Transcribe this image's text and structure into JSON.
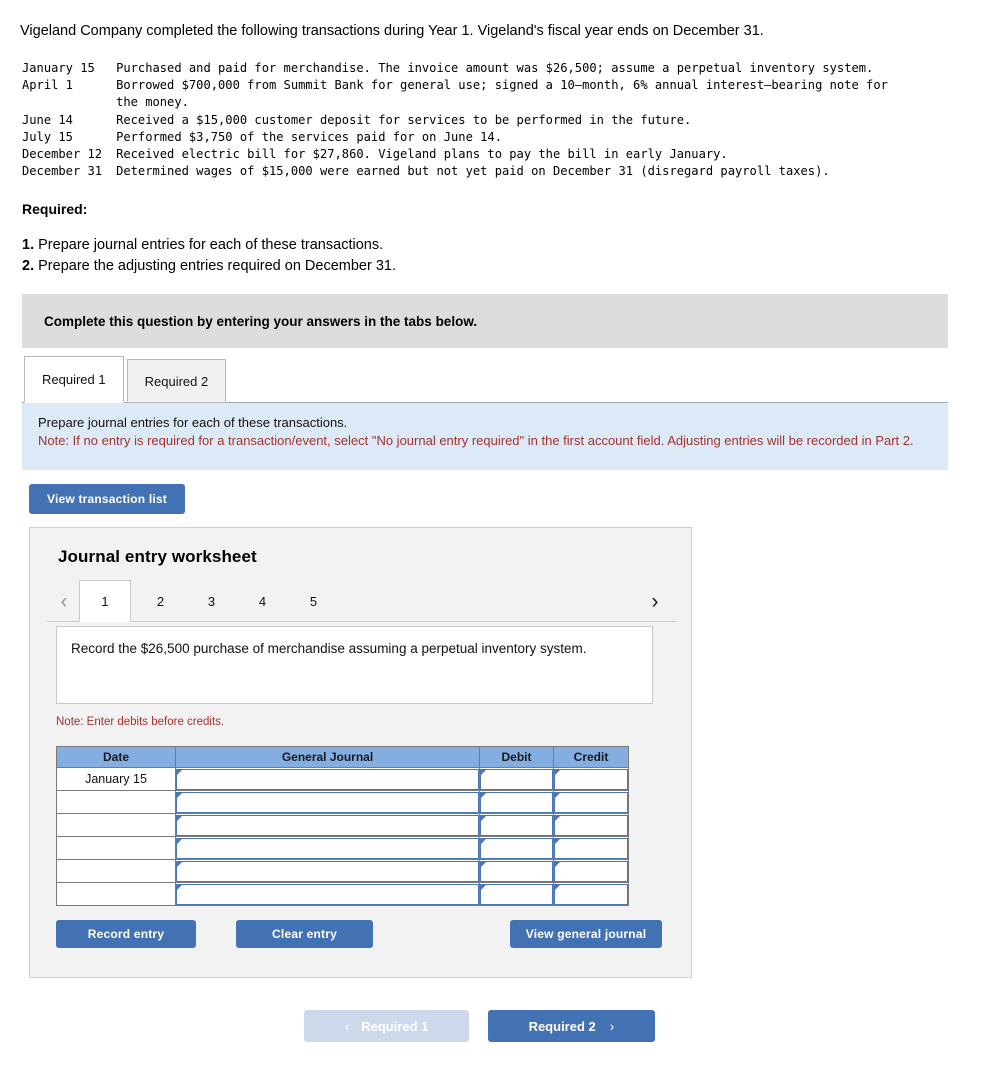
{
  "intro": "Vigeland Company completed the following transactions during Year 1. Vigeland's fiscal year ends on December 31.",
  "transactions": [
    {
      "date": "January 15",
      "description": "Purchased and paid for merchandise. The invoice amount was $26,500; assume a perpetual inventory system."
    },
    {
      "date": "April 1",
      "description": "Borrowed $700,000 from Summit Bank for general use; signed a 10–month, 6% annual interest–bearing note for the money."
    },
    {
      "date": "June 14",
      "description": "Received a $15,000 customer deposit for services to be performed in the future."
    },
    {
      "date": "July 15",
      "description": "Performed $3,750 of the services paid for on June 14."
    },
    {
      "date": "December 12",
      "description": "Received electric bill for $27,860. Vigeland plans to pay the bill in early January."
    },
    {
      "date": "December 31",
      "description": "Determined wages of $15,000 were earned but not yet paid on December 31 (disregard payroll taxes)."
    }
  ],
  "required": {
    "label": "Required:",
    "items": [
      {
        "num": "1.",
        "text": "Prepare journal entries for each of these transactions."
      },
      {
        "num": "2.",
        "text": "Prepare the adjusting entries required on December 31."
      }
    ]
  },
  "banner": "Complete this question by entering your answers in the tabs below.",
  "tabs": [
    {
      "label": "Required 1",
      "active": true
    },
    {
      "label": "Required 2",
      "active": false
    }
  ],
  "info_panel": {
    "line1": "Prepare journal entries for each of these transactions.",
    "note": "Note: If no entry is required for a transaction/event, select \"No journal entry required\" in the first account field. Adjusting entries will be recorded in Part 2."
  },
  "view_transaction_list_label": "View transaction list",
  "worksheet": {
    "title": "Journal entry worksheet",
    "pager": {
      "prev_icon": "chevron-left",
      "next_icon": "chevron-right",
      "pages": [
        "1",
        "2",
        "3",
        "4",
        "5"
      ],
      "active_page": "1"
    },
    "prompt": "Record the $26,500 purchase of merchandise assuming a perpetual inventory system.",
    "note": "Note: Enter debits before credits.",
    "table": {
      "headers": [
        "Date",
        "General Journal",
        "Debit",
        "Credit"
      ],
      "rows": [
        {
          "date": "January 15",
          "general_journal": "",
          "debit": "",
          "credit": ""
        },
        {
          "date": "",
          "general_journal": "",
          "debit": "",
          "credit": ""
        },
        {
          "date": "",
          "general_journal": "",
          "debit": "",
          "credit": ""
        },
        {
          "date": "",
          "general_journal": "",
          "debit": "",
          "credit": ""
        },
        {
          "date": "",
          "general_journal": "",
          "debit": "",
          "credit": ""
        },
        {
          "date": "",
          "general_journal": "",
          "debit": "",
          "credit": ""
        }
      ]
    },
    "buttons": {
      "record": "Record entry",
      "clear": "Clear entry",
      "view_general_journal": "View general journal"
    }
  },
  "bottom_nav": {
    "prev_label": "Required 1",
    "prev_arrow": "‹",
    "next_label": "Required 2",
    "next_arrow": "›"
  },
  "colors": {
    "accent_blue": "#4372b4",
    "table_header_blue": "#84ade2",
    "info_panel_blue": "#dce9f7",
    "banner_grey": "#dddddd",
    "note_red": "#a3332d",
    "disabled_blue": "#ccd9ea"
  }
}
